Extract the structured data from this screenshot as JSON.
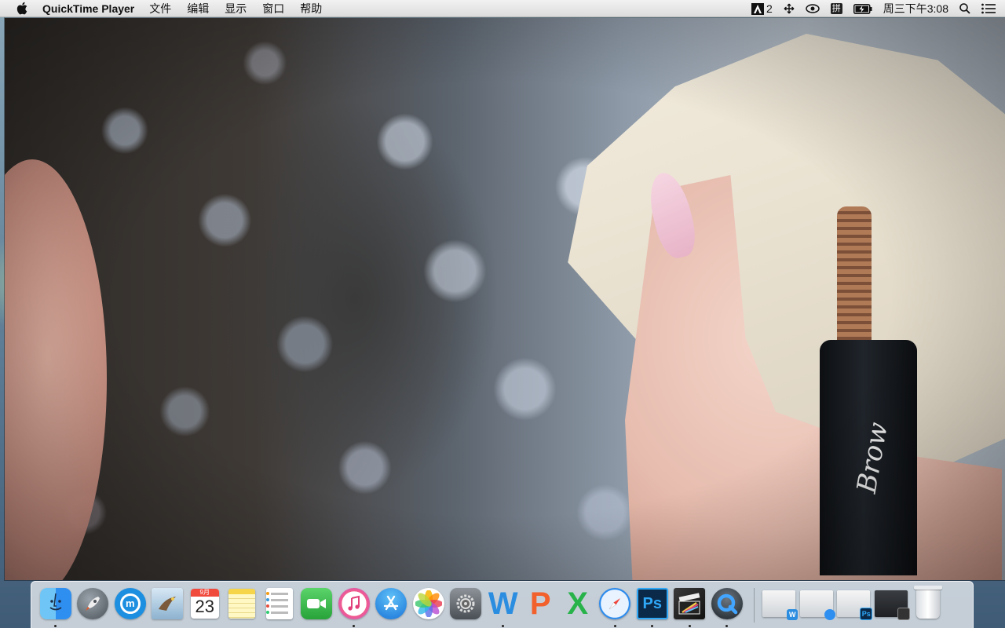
{
  "menubar": {
    "app_name": "QuickTime Player",
    "menus": [
      "文件",
      "编辑",
      "显示",
      "窗口",
      "帮助"
    ],
    "status": {
      "adobe_count": "2",
      "input_method": "拼",
      "clock": "周三下午3:08"
    }
  },
  "video": {
    "brand_text": "Brow"
  },
  "dock": {
    "calendar": {
      "month": "9月",
      "day": "23"
    },
    "apps": [
      {
        "name": "Finder",
        "icon": "finder-icon",
        "running": true
      },
      {
        "name": "Launchpad",
        "icon": "launchpad-icon",
        "running": false
      },
      {
        "name": "Maxthon",
        "icon": "maxthon-icon",
        "running": false
      },
      {
        "name": "Mail",
        "icon": "mail-icon",
        "running": false
      },
      {
        "name": "Calendar",
        "icon": "calendar-icon",
        "running": false
      },
      {
        "name": "Notes",
        "icon": "notes-icon",
        "running": false
      },
      {
        "name": "Reminders",
        "icon": "reminders-icon",
        "running": false
      },
      {
        "name": "FaceTime",
        "icon": "facetime-icon",
        "running": false
      },
      {
        "name": "iTunes",
        "icon": "itunes-icon",
        "running": true
      },
      {
        "name": "App Store",
        "icon": "app-store-icon",
        "running": false
      },
      {
        "name": "Photos",
        "icon": "photos-icon",
        "running": false
      },
      {
        "name": "System Preferences",
        "icon": "system-preferences-icon",
        "running": false
      },
      {
        "name": "Word",
        "icon": "word-icon",
        "glyph": "W",
        "running": true
      },
      {
        "name": "PowerPoint",
        "icon": "powerpoint-icon",
        "glyph": "P",
        "running": false
      },
      {
        "name": "Excel",
        "icon": "excel-icon",
        "glyph": "X",
        "running": false
      },
      {
        "name": "Safari",
        "icon": "safari-icon",
        "running": true
      },
      {
        "name": "Photoshop",
        "icon": "photoshop-icon",
        "glyph": "Ps",
        "running": true
      },
      {
        "name": "Final Cut Pro",
        "icon": "final-cut-pro-icon",
        "running": true
      },
      {
        "name": "QuickTime Player",
        "icon": "quicktime-icon",
        "running": true
      }
    ],
    "minimized": [
      {
        "name": "Word document",
        "badge": "W"
      },
      {
        "name": "Safari window",
        "badge": ""
      },
      {
        "name": "Photoshop document",
        "badge": "Ps"
      },
      {
        "name": "Final Cut Pro window",
        "badge": ""
      }
    ]
  },
  "colors": {
    "accent_blue": "#2f8ff0",
    "photoshop": "#0b2a4a",
    "word": "#2b8de0",
    "powerpoint": "#f2602b",
    "excel": "#28b34a"
  }
}
